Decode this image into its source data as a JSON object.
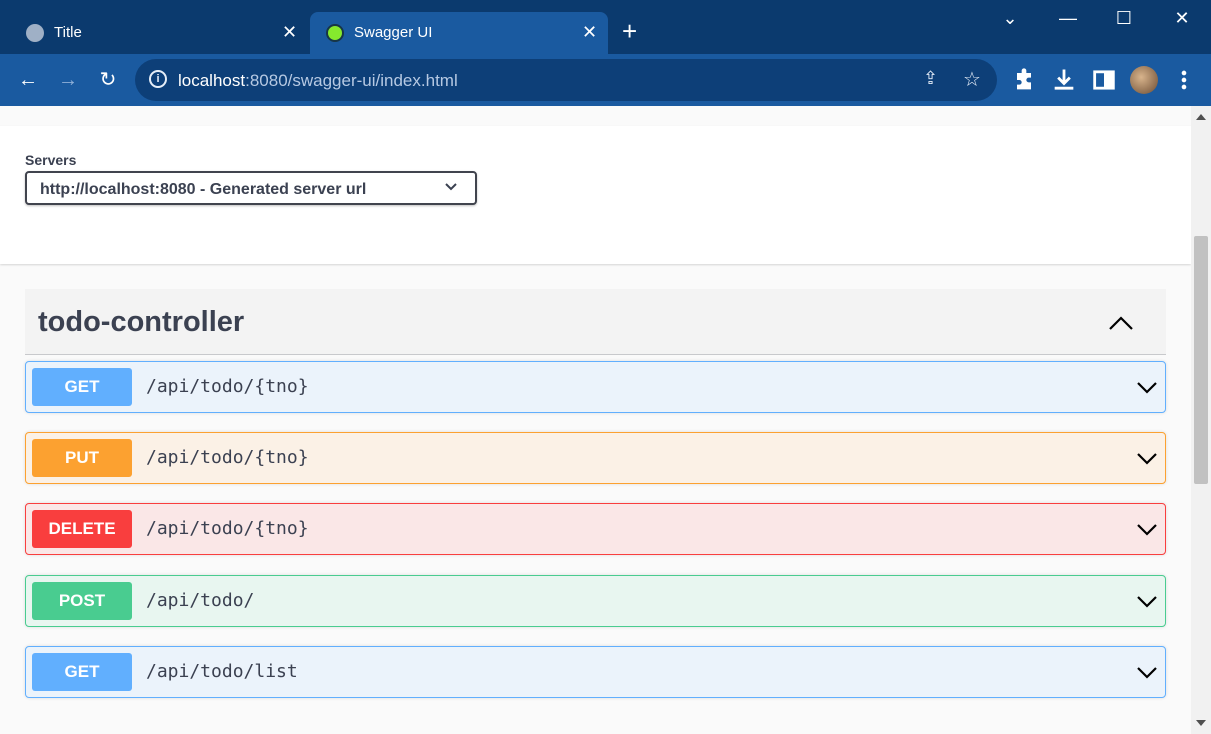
{
  "browser": {
    "tabs": [
      {
        "title": "Title",
        "active": false,
        "favicon": "globe-icon"
      },
      {
        "title": "Swagger UI",
        "active": true,
        "favicon": "swagger-icon"
      }
    ],
    "close_glyph": "✕",
    "new_tab_glyph": "+",
    "window_controls": {
      "minimize": "—",
      "maximize": "☐",
      "close": "✕",
      "tab_search": "⌄"
    },
    "toolbar": {
      "back": "←",
      "forward": "→",
      "reload": "↻"
    },
    "address": {
      "host": "localhost",
      "rest": ":8080/swagger-ui/index.html"
    },
    "extension_icons": [
      "puzzle-icon",
      "download-icon",
      "sidepanel-icon",
      "avatar",
      "kebab-menu-icon"
    ],
    "colors": {
      "frame": "#0b3a6e",
      "toolbar": "#1a5aa0",
      "omnibox": "#0d3f78"
    }
  },
  "servers": {
    "label": "Servers",
    "selected": "http://localhost:8080 - Generated server url"
  },
  "tag": {
    "name": "todo-controller",
    "expanded": true
  },
  "operations": [
    {
      "method": "GET",
      "path": "/api/todo/{tno}"
    },
    {
      "method": "PUT",
      "path": "/api/todo/{tno}"
    },
    {
      "method": "DELETE",
      "path": "/api/todo/{tno}"
    },
    {
      "method": "POST",
      "path": "/api/todo/"
    },
    {
      "method": "GET",
      "path": "/api/todo/list"
    }
  ],
  "method_colors": {
    "GET": "#61affe",
    "PUT": "#fca130",
    "DELETE": "#f93e3e",
    "POST": "#49cc90"
  }
}
